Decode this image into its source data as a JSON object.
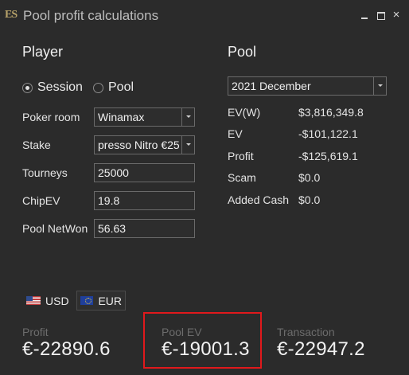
{
  "window": {
    "logo": "ES",
    "title": "Pool profit calculations",
    "close_glyph": "×"
  },
  "player": {
    "heading": "Player",
    "mode_options": [
      {
        "label": "Session",
        "selected": true
      },
      {
        "label": "Pool",
        "selected": false
      }
    ],
    "poker_room_label": "Poker room",
    "poker_room_value": "Winamax",
    "stake_label": "Stake",
    "stake_value": "presso Nitro €25",
    "tourneys_label": "Tourneys",
    "tourneys_value": "25000",
    "chipev_label": "ChipEV",
    "chipev_value": "19.8",
    "pool_netwon_label": "Pool NetWon",
    "pool_netwon_value": "56.63"
  },
  "pool": {
    "heading": "Pool",
    "period_value": "2021 December",
    "stats": [
      {
        "label": "EV(W)",
        "value": "$3,816,349.8"
      },
      {
        "label": "EV",
        "value": "-$101,122.1"
      },
      {
        "label": "Profit",
        "value": "-$125,619.1"
      },
      {
        "label": "Scam",
        "value": "$0.0"
      },
      {
        "label": "Added Cash",
        "value": "$0.0"
      }
    ]
  },
  "currency": {
    "options": [
      {
        "label": "USD",
        "icon": "us-flag-icon",
        "selected": false
      },
      {
        "label": "EUR",
        "icon": "eu-flag-icon",
        "selected": true
      }
    ]
  },
  "summary": {
    "profit_label": "Profit",
    "profit_value": "€-22890.6",
    "pool_ev_label": "Pool EV",
    "pool_ev_value": "€-19001.3",
    "transaction_label": "Transaction",
    "transaction_value": "€-22947.2"
  },
  "colors": {
    "background": "#2b2b2b",
    "highlight_border": "#e0191c",
    "muted_label": "#6c6c6c"
  }
}
